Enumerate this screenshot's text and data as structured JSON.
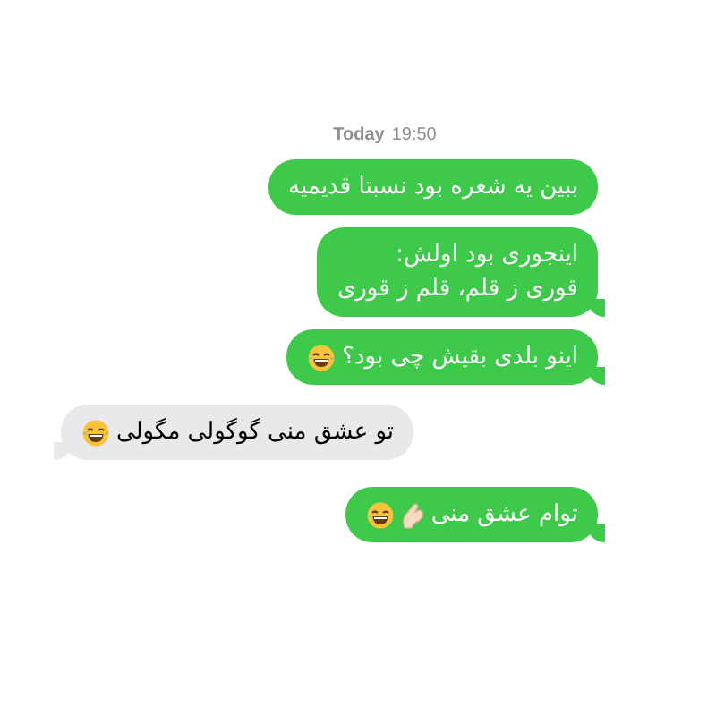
{
  "timestamp": {
    "day": "Today",
    "time": "19:50"
  },
  "messages": [
    {
      "kind": "sent",
      "tail": false,
      "lines": [
        "ببین یه شعره بود نسبتا قدیمیه"
      ]
    },
    {
      "kind": "sent",
      "tail": true,
      "lines": [
        "اینجوری بود اولش:",
        "قوری ز قلم، قلم ز قوری"
      ]
    },
    {
      "kind": "sent",
      "tail": true,
      "lines": [
        "اینو بلدی بقیش چی بود؟"
      ],
      "icons": [
        {
          "kind": "laughing"
        }
      ]
    },
    {
      "kind": "received",
      "tail": true,
      "lines": [
        "تو عشق منی گوگولی مگولی"
      ],
      "icons": [
        {
          "kind": "laughing"
        }
      ]
    },
    {
      "kind": "sent",
      "tail": true,
      "lines": [
        "توام عشق منی"
      ],
      "icons": [
        {
          "kind": "pinch"
        },
        {
          "kind": "laughing"
        }
      ]
    }
  ]
}
